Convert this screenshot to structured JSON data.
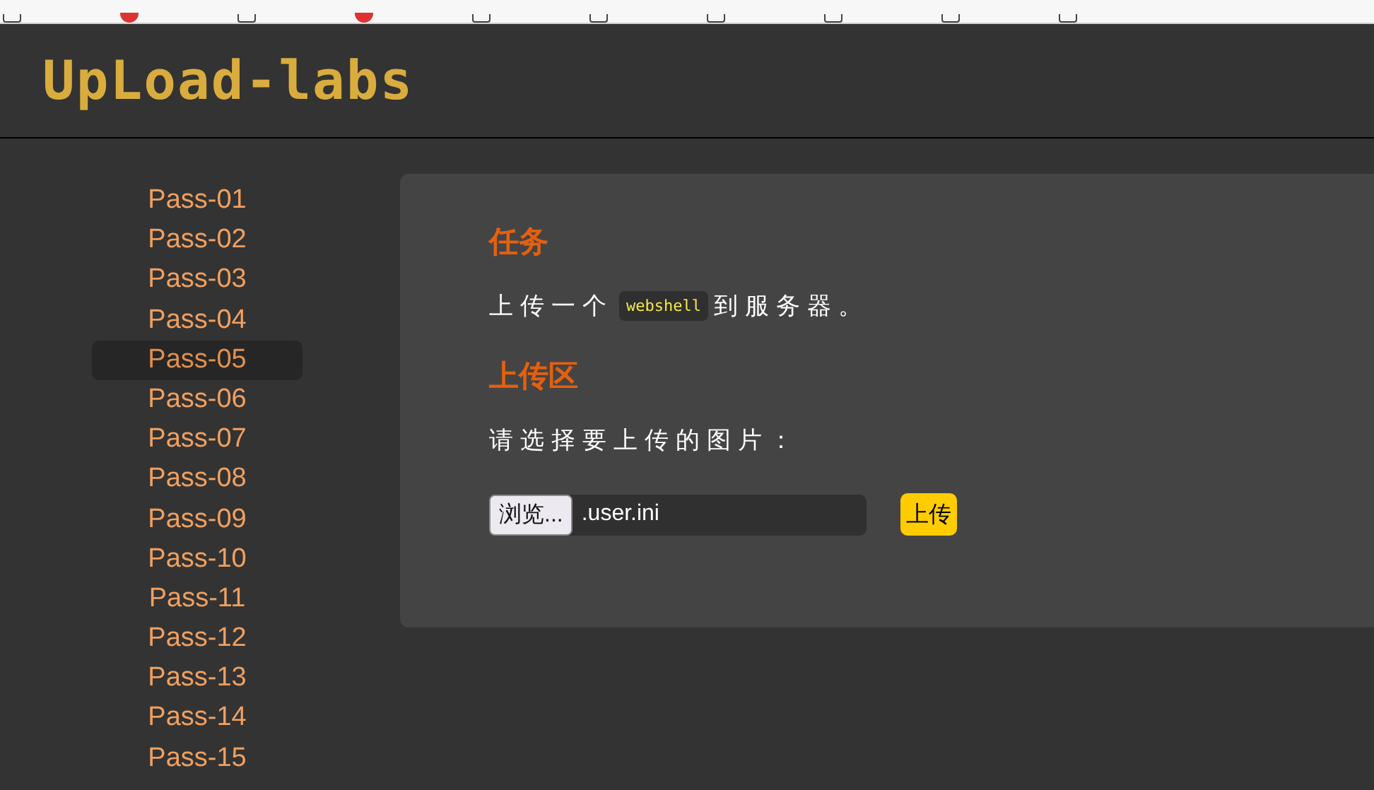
{
  "bookmarks_bar": {
    "items": [
      {
        "kind": "folder"
      },
      {
        "kind": "site"
      },
      {
        "kind": "folder"
      },
      {
        "kind": "site"
      },
      {
        "kind": "folder"
      },
      {
        "kind": "folder"
      },
      {
        "kind": "folder"
      },
      {
        "kind": "folder"
      },
      {
        "kind": "folder"
      },
      {
        "kind": "folder"
      }
    ]
  },
  "header": {
    "logo": "UpLoad-labs"
  },
  "sidebar": {
    "items": [
      {
        "label": "Pass-01",
        "selected": false
      },
      {
        "label": "Pass-02",
        "selected": false
      },
      {
        "label": "Pass-03",
        "selected": false
      },
      {
        "label": "Pass-04",
        "selected": false
      },
      {
        "label": "Pass-05",
        "selected": true
      },
      {
        "label": "Pass-06",
        "selected": false
      },
      {
        "label": "Pass-07",
        "selected": false
      },
      {
        "label": "Pass-08",
        "selected": false
      },
      {
        "label": "Pass-09",
        "selected": false
      },
      {
        "label": "Pass-10",
        "selected": false
      },
      {
        "label": "Pass-11",
        "selected": false
      },
      {
        "label": "Pass-12",
        "selected": false
      },
      {
        "label": "Pass-13",
        "selected": false
      },
      {
        "label": "Pass-14",
        "selected": false
      },
      {
        "label": "Pass-15",
        "selected": false
      }
    ]
  },
  "content": {
    "task_heading": "任务",
    "task_before": "上传一个",
    "task_code": "webshell",
    "task_after": "到服务器。",
    "upload_heading": "上传区",
    "upload_prompt": "请选择要上传的图片：",
    "file_input": {
      "button": "浏览...",
      "value": ".user.ini"
    },
    "submit_button": "上传"
  }
}
